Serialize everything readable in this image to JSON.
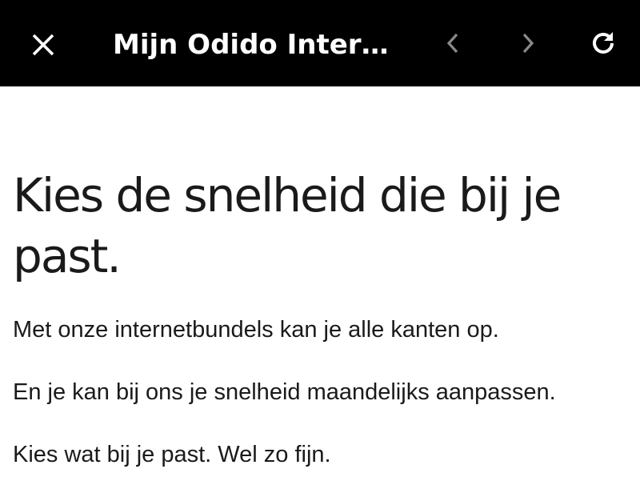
{
  "browser_bar": {
    "title": "Mijn Odido Interne...",
    "close_icon": "close-icon",
    "back_icon": "chevron-left-icon",
    "forward_icon": "chevron-right-icon",
    "reload_icon": "reload-icon",
    "back_enabled": false,
    "forward_enabled": false
  },
  "page": {
    "headline": "Kies de snelheid die bij je past.",
    "paragraphs": [
      "Met onze internetbundels kan je alle kanten op.",
      "En je kan bij ons je snelheid maandelijks aanpassen.",
      "Kies wat bij je past. Wel zo fijn."
    ]
  },
  "colors": {
    "bar_background": "#000000",
    "bar_foreground": "#ffffff",
    "nav_disabled": "#8a8a8a",
    "text": "#1a1a1a",
    "page_background": "#ffffff"
  }
}
